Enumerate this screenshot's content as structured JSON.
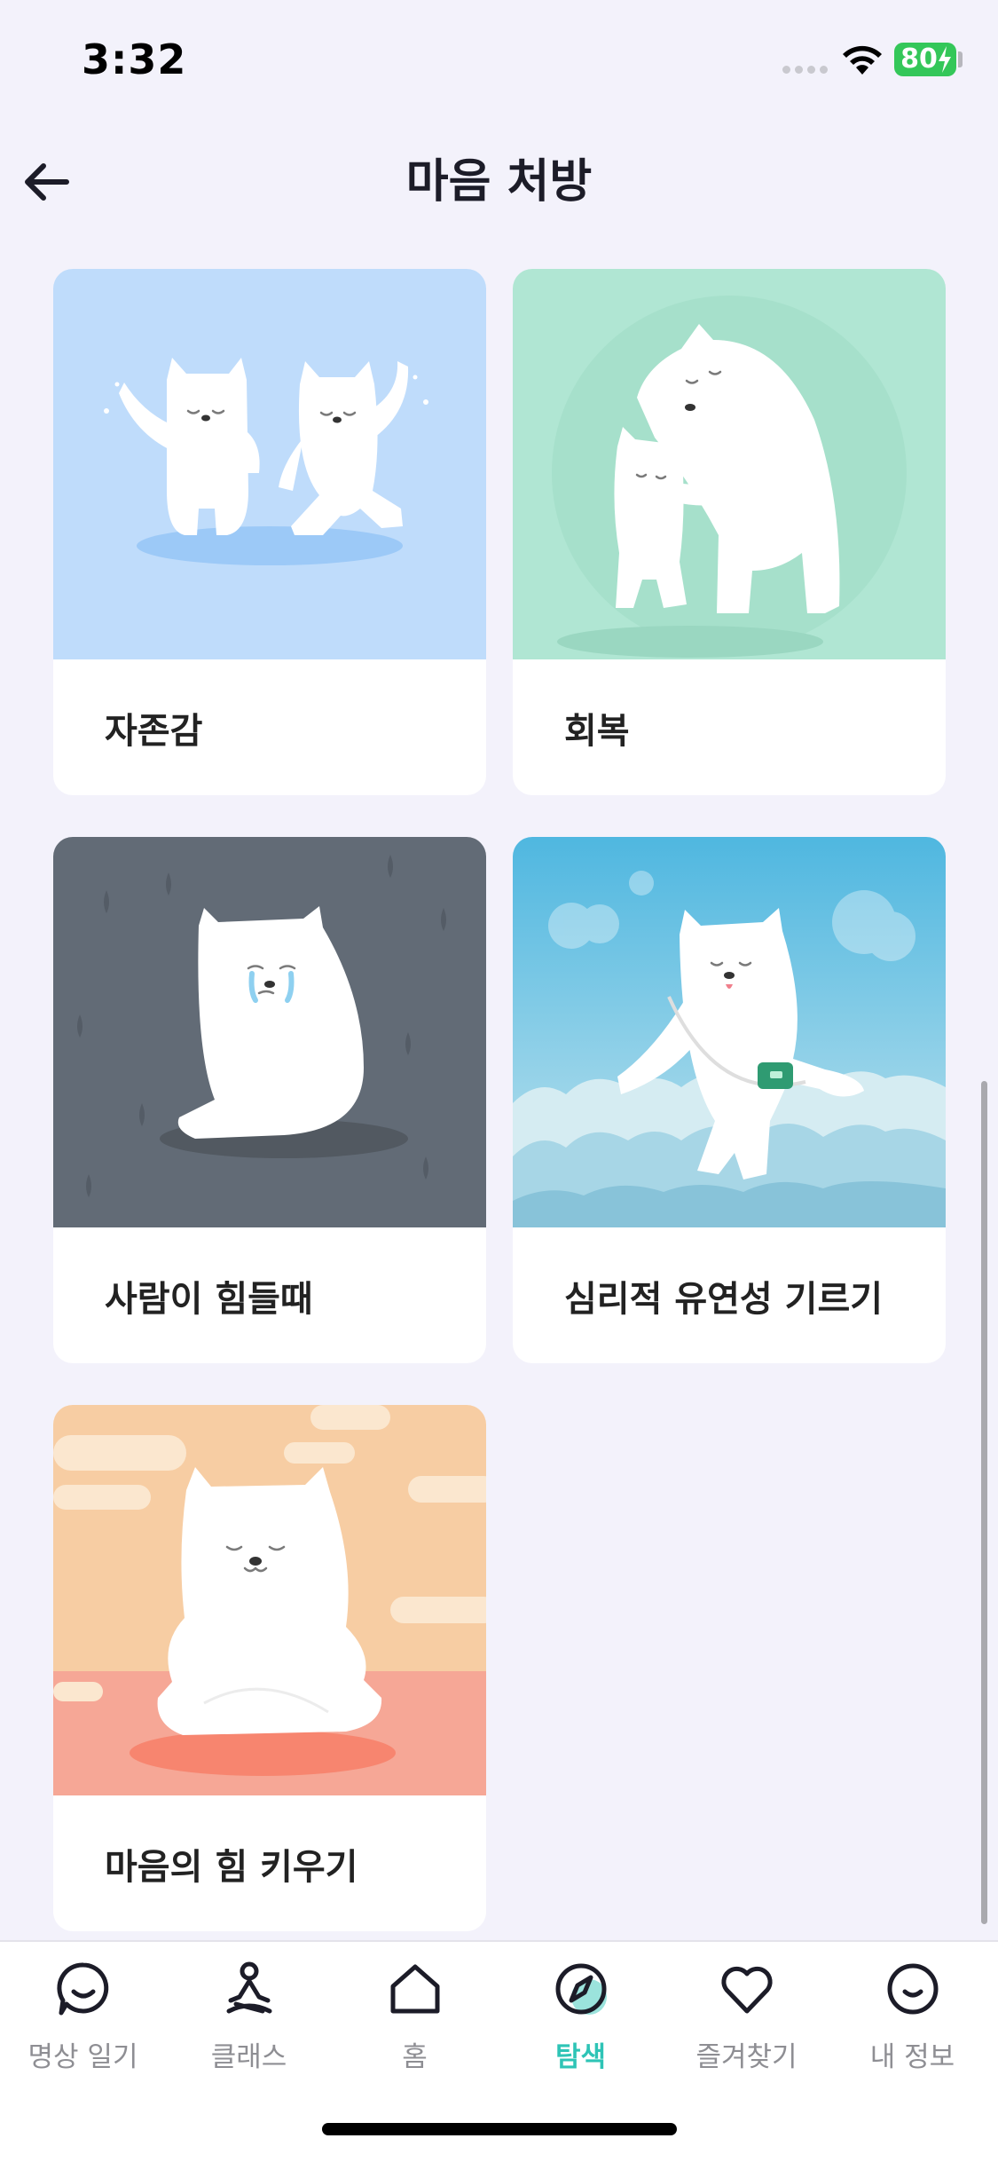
{
  "status_bar": {
    "time": "3:32",
    "battery": "80"
  },
  "nav": {
    "title": "마음 처방"
  },
  "cards": [
    {
      "label": "자존감",
      "bg": "#bfdcfb"
    },
    {
      "label": "회복",
      "bg": "#b0e6d3"
    },
    {
      "label": "사람이 힘들때",
      "bg": "#626b76"
    },
    {
      "label": "심리적 유연성 기르기",
      "bg": "#7fc5e0"
    },
    {
      "label": "마음의 힘 키우기",
      "bg": "#f7cda3"
    }
  ],
  "tabs": [
    {
      "label": "명상 일기",
      "icon": "chat-smile-icon"
    },
    {
      "label": "클래스",
      "icon": "meditation-icon"
    },
    {
      "label": "홈",
      "icon": "home-icon"
    },
    {
      "label": "탐색",
      "icon": "compass-icon",
      "active": true
    },
    {
      "label": "즐겨찾기",
      "icon": "heart-icon"
    },
    {
      "label": "내 정보",
      "icon": "smile-icon"
    }
  ],
  "colors": {
    "accent": "#2ec4b6",
    "background": "#f3f2fb"
  }
}
